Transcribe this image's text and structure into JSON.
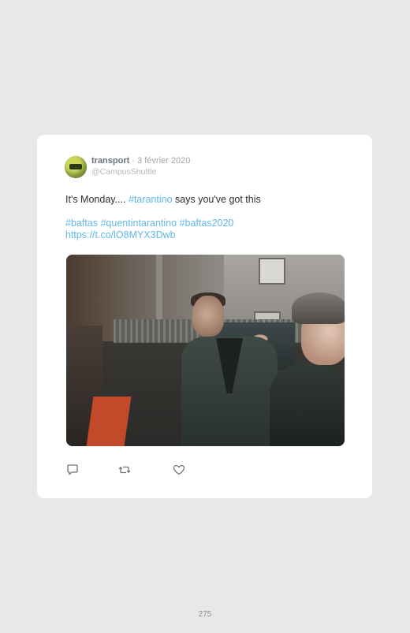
{
  "tweet": {
    "author_name": "transport",
    "separator": "·",
    "date": "3 février 2020",
    "handle": "@CampusShuttle",
    "text_prefix": "It's Monday.... ",
    "text_hashtag": "#tarantino",
    "text_suffix": " says you've got this",
    "hashtags": "#baftas #quentintarantino #baftas2020",
    "link": "https://t.co/lO8MYX3Dwb"
  },
  "actions": {
    "reply_icon": "reply-icon",
    "retweet_icon": "retweet-icon",
    "like_icon": "heart-icon"
  },
  "page": {
    "number": "275"
  },
  "colors": {
    "link": "#62b8e6",
    "background": "#e8e8e8",
    "card": "#ffffff"
  }
}
